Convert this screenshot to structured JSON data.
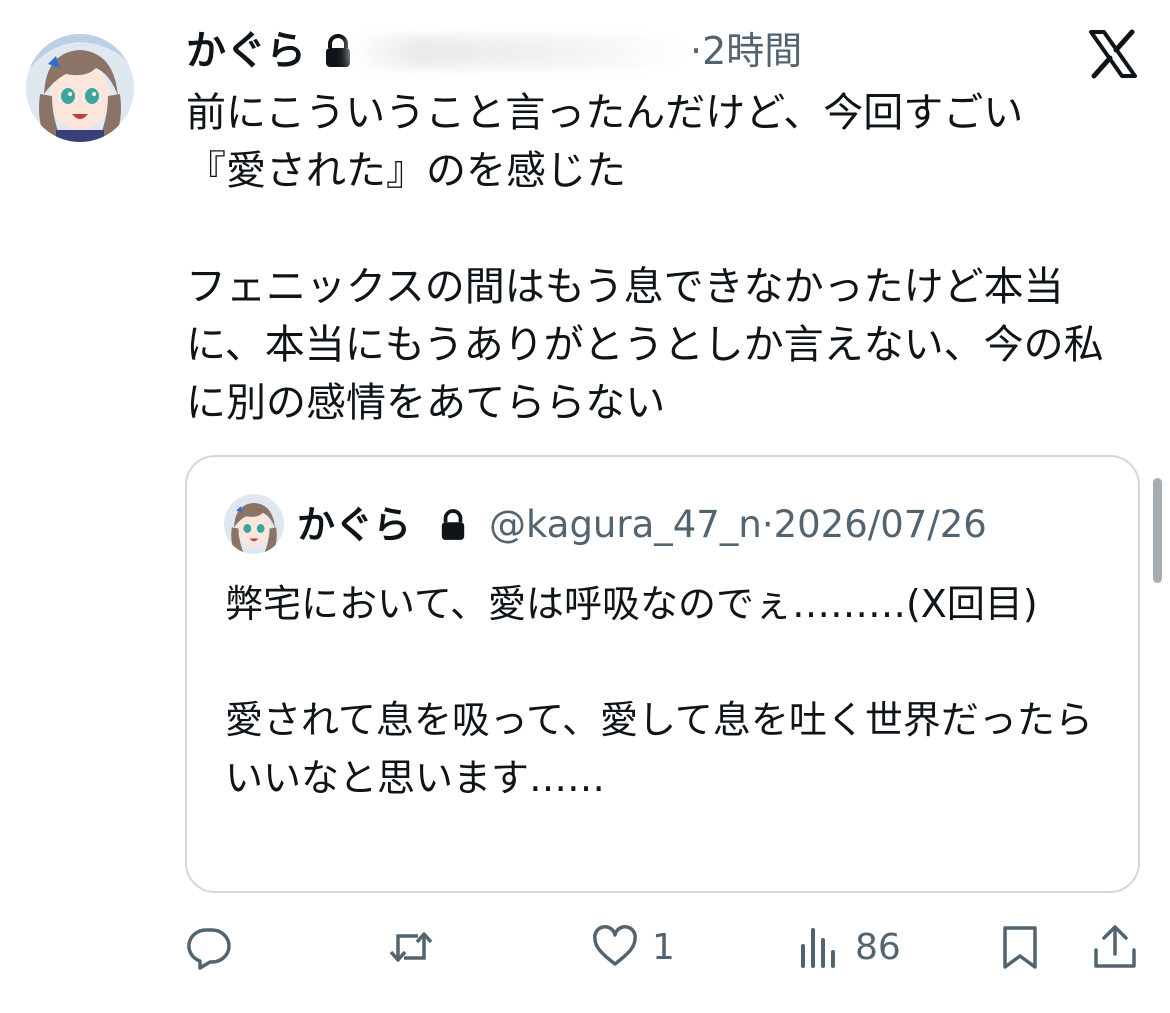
{
  "post": {
    "author_name": "かぐら",
    "time": "2時間",
    "text": "前にこういうこと言ったんだけど、今回すごい\n『愛された』のを感じた\n\nフェニックスの間はもう息できなかったけど本当に、本当にもうありがとうとしか言えない、今の私に別の感情をあてららない",
    "icons": {
      "lock": "lock-icon",
      "brand": "x-logo-icon"
    }
  },
  "quote": {
    "author_name": "かぐら",
    "handle": "@kagura_47_n",
    "separator": "·",
    "date": "2026/07/26",
    "text": "弊宅において、愛は呼吸なのでぇ………(X回目)\n\n愛されて息を吸って、愛して息を吐く世界だったらいいなと思います……"
  },
  "actions": {
    "reply": {
      "icon": "reply-icon",
      "count": ""
    },
    "repost": {
      "icon": "repost-icon",
      "count": ""
    },
    "like": {
      "icon": "heart-icon",
      "count": "1"
    },
    "views": {
      "icon": "views-icon",
      "count": "86"
    },
    "bookmark": {
      "icon": "bookmark-icon"
    },
    "share": {
      "icon": "share-icon"
    }
  },
  "colors": {
    "text": "#0f1419",
    "secondary": "#536471",
    "border": "#cfd9de"
  }
}
